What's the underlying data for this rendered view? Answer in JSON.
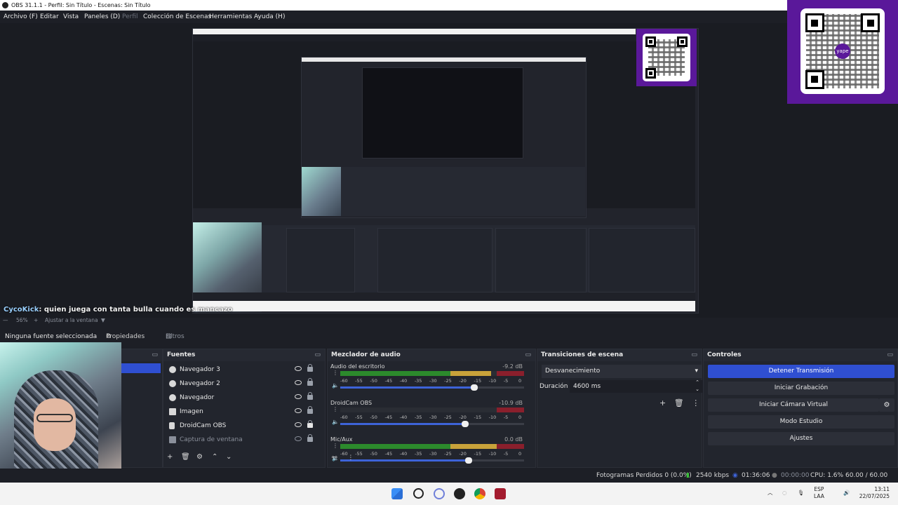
{
  "window": {
    "title": "OBS 31.1.1 - Perfil: Sin Título - Escenas: Sin Título"
  },
  "menu": [
    {
      "label": "Archivo (F)",
      "enabled": true
    },
    {
      "label": "Editar",
      "enabled": true
    },
    {
      "label": "Vista",
      "enabled": true
    },
    {
      "label": "Paneles (D)",
      "enabled": true
    },
    {
      "label": "Perfil",
      "enabled": false
    },
    {
      "label": "Colección de Escenas",
      "enabled": true
    },
    {
      "label": "Herramientas",
      "enabled": true
    },
    {
      "label": "Ayuda (H)",
      "enabled": true
    }
  ],
  "chat": {
    "user": "CycoKick",
    "message": ": quien juega con tanta bulla cuando es mancazo"
  },
  "zoom": {
    "value": "56%",
    "plus": "+",
    "fit_label": "Ajustar a la ventana"
  },
  "source_bar": {
    "selected_source": "Ninguna fuente seleccionada",
    "properties_label": "Propiedades",
    "filters_label": "Filtros"
  },
  "docks": {
    "sources": {
      "title": "Fuentes",
      "items": [
        {
          "label": "Navegador 3",
          "icon": "browser-icon"
        },
        {
          "label": "Navegador 2",
          "icon": "browser-icon"
        },
        {
          "label": "Navegador",
          "icon": "browser-icon"
        },
        {
          "label": "Imagen",
          "icon": "image-icon"
        },
        {
          "label": "DroidCam OBS",
          "icon": "camera-icon"
        },
        {
          "label": "Captura de ventana",
          "icon": "window-icon"
        }
      ]
    },
    "mixer": {
      "title": "Mezclador de audio",
      "ticks": [
        "-60",
        "-55",
        "-50",
        "-45",
        "-40",
        "-35",
        "-30",
        "-25",
        "-20",
        "-15",
        "-10",
        "-5",
        "0"
      ],
      "channels": [
        {
          "name": "Audio del escritorio",
          "db": "-9.2 dB",
          "level": 0.82,
          "volume": 0.73
        },
        {
          "name": "DroidCam OBS",
          "db": "-10.9 dB",
          "level": 0.0,
          "volume": 0.68
        },
        {
          "name": "Mic/Aux",
          "db": "0.0 dB",
          "level": 0.97,
          "volume": 0.7
        }
      ]
    },
    "transitions": {
      "title": "Transiciones de escena",
      "selected": "Desvanecimiento",
      "duration_label": "Duración",
      "duration_value": "4600 ms"
    },
    "controls": {
      "title": "Controles",
      "buttons": [
        "Detener Transmisión",
        "Iniciar Grabación",
        "Iniciar Cámara Virtual",
        "Modo Estudio",
        "Ajustes"
      ]
    }
  },
  "status": {
    "dropped_frames": "Fotogramas Perdidos 0 (0.0%)",
    "bitrate": "2540 kbps",
    "stream_time": "01:36:06",
    "rec_time": "00:00:00",
    "cpu": "CPU: 1.6%",
    "fps": "60.00 / 60.00 FPS"
  },
  "taskbar": {
    "lang_top": "ESP",
    "lang_bottom": "LAA",
    "time": "13:11",
    "date": "22/07/2025"
  },
  "qr_badge": {
    "logo_text": "yape"
  },
  "colors": {
    "accent": "#2f4fd1",
    "qr_purple": "#5a189a",
    "meter_green": "#2c8a2c",
    "meter_yellow": "#c8a23a",
    "meter_red": "#8a1f2c"
  }
}
